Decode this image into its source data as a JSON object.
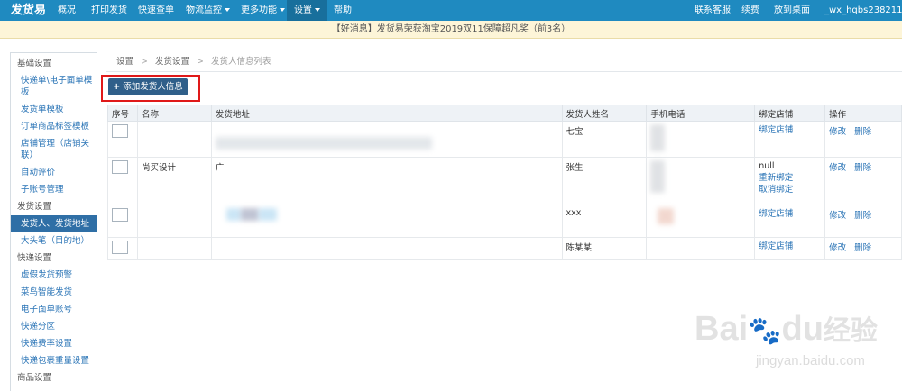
{
  "topnav": {
    "logo": "发货易",
    "items": [
      {
        "label": "概况"
      },
      {
        "label": "打印发货"
      },
      {
        "label": "快速查单"
      },
      {
        "label": "物流监控"
      },
      {
        "label": "更多功能"
      },
      {
        "label": "设置"
      },
      {
        "label": "帮助"
      }
    ],
    "right": {
      "service": "联系客服",
      "renew": "续费",
      "desktop": "放到桌面",
      "user": "wx_hqbs238211"
    }
  },
  "notice": "【好消息】发货易荣获淘宝2019双11保障超凡奖（前3名）",
  "sidebar": {
    "sections": [
      {
        "title": "基础设置",
        "items": [
          "快递单\\电子面单模板",
          "发货单模板",
          "订单商品标签模板",
          "店铺管理（店铺关联）",
          "自动评价",
          "子账号管理"
        ]
      },
      {
        "title": "发货设置",
        "items": [
          "发货人、发货地址",
          "大头笔（目的地）"
        ]
      },
      {
        "title": "快递设置",
        "items": [
          "虚假发货预警",
          "菜鸟智能发货",
          "电子面单账号",
          "快递分区",
          "快递费率设置",
          "快递包裹重量设置"
        ]
      },
      {
        "title": "商品设置",
        "items": []
      }
    ],
    "active": "发货人、发货地址"
  },
  "breadcrumb": {
    "l1": "设置",
    "l2": "发货设置",
    "l3": "发货人信息列表"
  },
  "add_button": "添加发货人信息",
  "table": {
    "headers": [
      "序号",
      "名称",
      "发货地址",
      "发货人姓名",
      "手机电话",
      "绑定店铺",
      "操作"
    ],
    "rows": [
      {
        "name": "",
        "address": "",
        "sender": "七宝",
        "phone": "",
        "bind": [
          "绑定店铺"
        ],
        "ops": [
          "修改",
          "删除"
        ]
      },
      {
        "name": "尚买设计",
        "address": "广",
        "sender": "张生",
        "phone": "",
        "bind": [
          "null",
          "重新绑定",
          "取消绑定"
        ],
        "ops": [
          "修改",
          "删除"
        ]
      },
      {
        "name": "",
        "address": "",
        "sender": "xxx",
        "phone": "",
        "bind": [
          "绑定店铺"
        ],
        "ops": [
          "修改",
          "删除"
        ]
      },
      {
        "name": "",
        "address": "",
        "sender": "陈某某",
        "phone": "",
        "bind": [
          "绑定店铺"
        ],
        "ops": [
          "修改",
          "删除"
        ]
      }
    ]
  },
  "watermark": {
    "brand": "Bai",
    "brand2": "du",
    "cn": "经验",
    "url": "jingyan.baidu.com"
  }
}
